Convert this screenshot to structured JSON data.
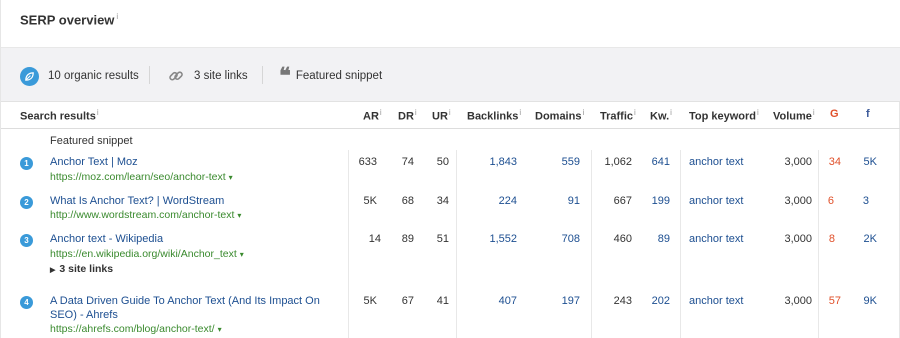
{
  "header": {
    "title": "SERP overview",
    "info": "i"
  },
  "summary": {
    "organic": "10 organic results",
    "sitelinks": "3 site links",
    "featured": "Featured snippet"
  },
  "columns": {
    "search_results": "Search results",
    "ar": "AR",
    "dr": "DR",
    "ur": "UR",
    "backlinks": "Backlinks",
    "domains": "Domains",
    "traffic": "Traffic",
    "kw": "Kw.",
    "top_keyword": "Top keyword",
    "volume": "Volume",
    "g": "G",
    "f": "f",
    "info": "i"
  },
  "featured_label": "Featured snippet",
  "rows": [
    {
      "num": "1",
      "title": "Anchor Text | Moz",
      "url": "https://moz.com/learn/seo/anchor-text",
      "ar": "633",
      "dr": "74",
      "ur": "50",
      "backlinks": "1,843",
      "domains": "559",
      "traffic": "1,062",
      "kw": "641",
      "keyword": "anchor text",
      "volume": "3,000",
      "g": "34",
      "f": "5K"
    },
    {
      "num": "2",
      "title": "What Is Anchor Text? | WordStream",
      "url": "http://www.wordstream.com/anchor-text",
      "ar": "5K",
      "dr": "68",
      "ur": "34",
      "backlinks": "224",
      "domains": "91",
      "traffic": "667",
      "kw": "199",
      "keyword": "anchor text",
      "volume": "3,000",
      "g": "6",
      "f": "3"
    },
    {
      "num": "3",
      "title": "Anchor text - Wikipedia",
      "url": "https://en.wikipedia.org/wiki/Anchor_text",
      "sitelinks": "3 site links",
      "ar": "14",
      "dr": "89",
      "ur": "51",
      "backlinks": "1,552",
      "domains": "708",
      "traffic": "460",
      "kw": "89",
      "keyword": "anchor text",
      "volume": "3,000",
      "g": "8",
      "f": "2K"
    },
    {
      "num": "4",
      "title_line1": "A Data Driven Guide To Anchor Text (And Its Impact On",
      "title_line2": "SEO) - Ahrefs",
      "url": "https://ahrefs.com/blog/anchor-text/",
      "ar": "5K",
      "dr": "67",
      "ur": "41",
      "backlinks": "407",
      "domains": "197",
      "traffic": "243",
      "kw": "202",
      "keyword": "anchor text",
      "volume": "3,000",
      "g": "57",
      "f": "9K"
    }
  ],
  "caret": "▾",
  "tri": "▶",
  "colors": {
    "accent": "#3a9ad9",
    "link": "#1d4f91",
    "url": "#3a8a2e",
    "google": "#e0502a",
    "facebook": "#3b5998"
  },
  "icons": {
    "organic": "leaf-icon",
    "sitelinks": "link-icon",
    "featured": "quote-icon"
  }
}
